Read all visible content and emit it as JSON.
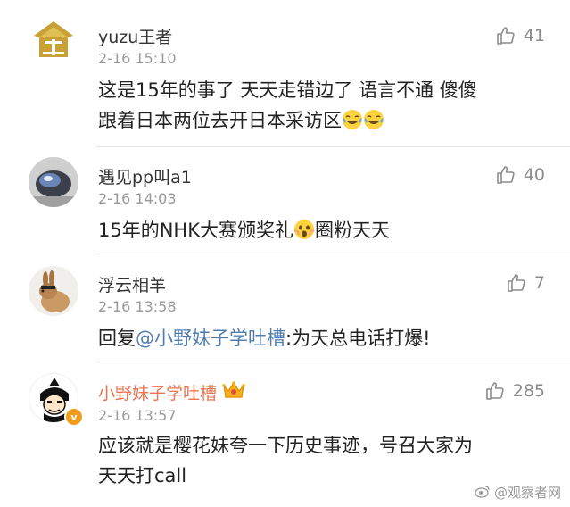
{
  "comments": [
    {
      "username": "yuzu王者",
      "time": "2-16 15:10",
      "likes": "41",
      "text_line1": "这是15年的事了 天天走错边了 语言不通 傻傻",
      "text_line2": "跟着日本两位去开日本采访区",
      "avatar_icon": "gold-coin-avatar",
      "inline_emojis": [
        "laugh-cry-emoji",
        "laugh-cry-emoji"
      ]
    },
    {
      "username": "遇见pp叫a1",
      "time": "2-16 14:03",
      "likes": "40",
      "text_before": "15年的NHK大赛颁奖礼",
      "text_after": "圈粉天天",
      "avatar_icon": "photo-avatar",
      "inline_emojis": [
        "scared-face-emoji"
      ]
    },
    {
      "username": "浮云相羊",
      "time": "2-16 13:58",
      "likes": "7",
      "reply_prefix": "回复",
      "mention": "@小野妹子学吐槽",
      "reply_text": ":为天总电话打爆!",
      "avatar_icon": "rabbit-avatar"
    },
    {
      "username": "小野妹子学吐槽",
      "time": "2-16 13:57",
      "likes": "285",
      "text_line1": "应该就是樱花妹夸一下历史事迹，号召大家为",
      "text_line2": "天天打call",
      "avatar_icon": "cartoon-man-avatar",
      "badge": "crown-icon",
      "verified": "v"
    }
  ],
  "watermark": "@观察者网",
  "colors": {
    "vip_name": "#eb7350",
    "mention": "#507daf",
    "meta": "#9a9a9a"
  }
}
